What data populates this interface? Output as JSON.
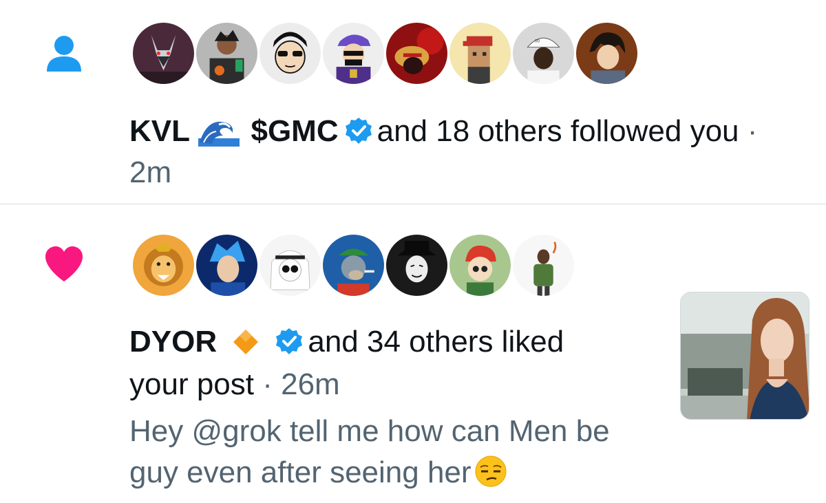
{
  "notifications": [
    {
      "type": "follow",
      "icon": "person-icon",
      "icon_color": "#1d9bf0",
      "avatar_count": 8,
      "name": "KVL",
      "name_emoji": "wave-emoji",
      "name2": "$GMC",
      "name2_verified": true,
      "action": "and 18 others followed you",
      "separator": "·",
      "time": "2m"
    },
    {
      "type": "like",
      "icon": "heart-icon",
      "icon_color": "#f91880",
      "avatar_count": 7,
      "name": "DYOR",
      "name_emoji": "orange-diamond-emoji",
      "name_verified": true,
      "action_line1": "and 34 others liked",
      "action_line2": "your post",
      "separator": "·",
      "time": "26m",
      "post_text_line1": "Hey @grok tell me how can Men be",
      "post_text_line2": "guy even after seeing her",
      "post_emoji": "unamused-face-emoji",
      "media_thumbnail": "photo-thumbnail"
    }
  ],
  "colors": {
    "verified_badge": "#1d9bf0",
    "secondary_text": "#536471",
    "divider": "#d9dde1"
  }
}
